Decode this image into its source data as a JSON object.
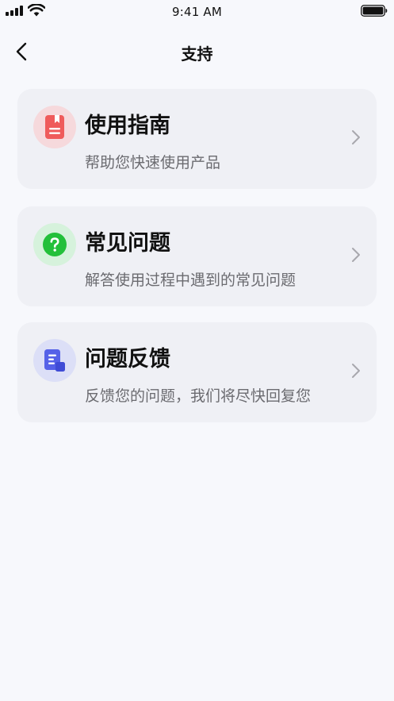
{
  "status_bar": {
    "time": "9:41 AM"
  },
  "nav": {
    "title": "支持",
    "back_icon": "chevron-left-icon"
  },
  "items": [
    {
      "title": "使用指南",
      "subtitle": "帮助您快速使用产品",
      "icon": "guide-book-icon",
      "icon_bg": "#f6d9dc",
      "icon_color": "#ef5b5b"
    },
    {
      "title": "常见问题",
      "subtitle": "解答使用过程中遇到的常见问题",
      "icon": "question-circle-icon",
      "icon_bg": "#d6f2dc",
      "icon_color": "#23c03a"
    },
    {
      "title": "问题反馈",
      "subtitle": "反馈您的问题，我们将尽快回复您",
      "icon": "feedback-document-icon",
      "icon_bg": "#dcdff7",
      "icon_color": "#5561e8"
    }
  ]
}
